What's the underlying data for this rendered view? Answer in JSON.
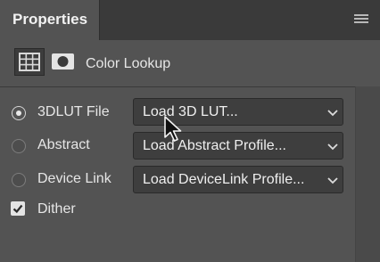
{
  "panel": {
    "tab_label": "Properties",
    "menu_icon": "panel-menu-icon"
  },
  "header": {
    "adjustment_icon": "grid-table-icon",
    "mask_icon": "layer-mask-icon",
    "title": "Color Lookup"
  },
  "options": [
    {
      "label": "3DLUT File",
      "selected": true,
      "value": "Load 3D LUT..."
    },
    {
      "label": "Abstract",
      "selected": false,
      "value": "Load Abstract Profile..."
    },
    {
      "label": "Device Link",
      "selected": false,
      "value": "Load DeviceLink Profile..."
    }
  ],
  "dither": {
    "label": "Dither",
    "checked": true
  },
  "colors": {
    "panel_bg": "#535353",
    "tabbar_bg": "#3a3a3a",
    "select_bg": "#3e3e3e",
    "text": "#e6e6e6"
  }
}
